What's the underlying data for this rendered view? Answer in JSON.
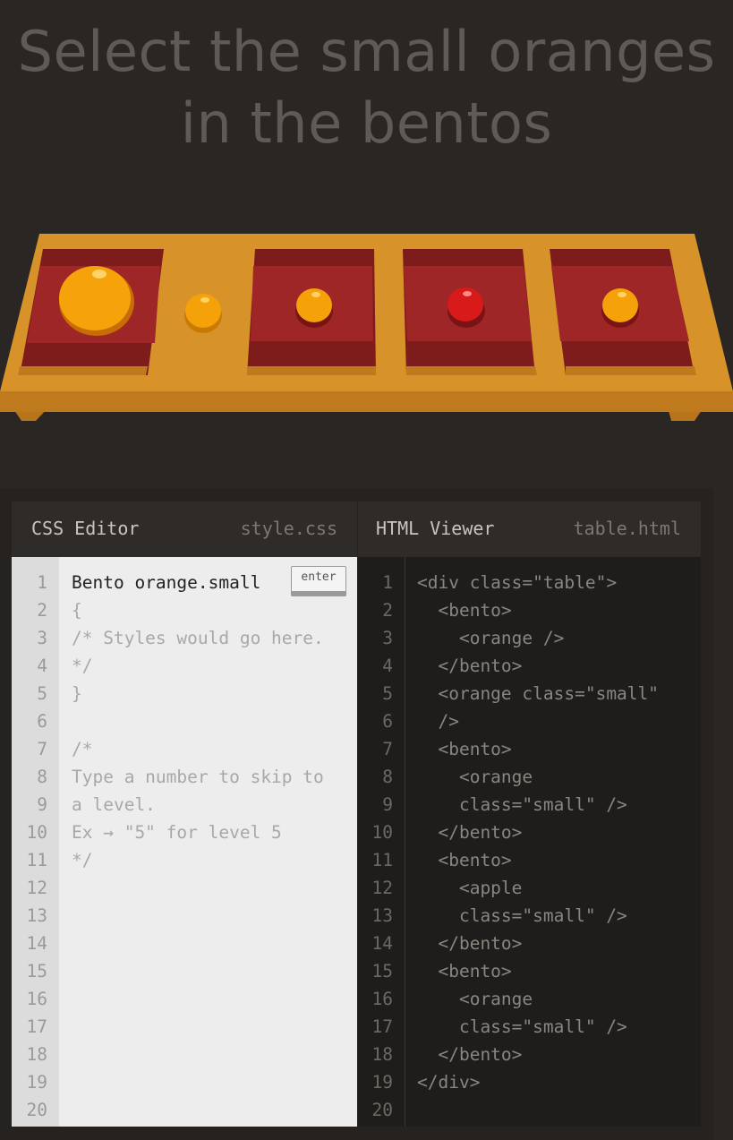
{
  "level": {
    "instruction_line1": "Select the small oranges",
    "instruction_line2": "in the bentos"
  },
  "table_items": [
    {
      "type": "bento",
      "contains": "orange"
    },
    {
      "type": "orange",
      "class": "small"
    },
    {
      "type": "bento",
      "contains": "orange small"
    },
    {
      "type": "bento",
      "contains": "apple small"
    },
    {
      "type": "bento",
      "contains": "orange small"
    }
  ],
  "colors": {
    "background": "#2a2623",
    "table": "#d8922a",
    "bento": "#8f1e1e",
    "orange": "#f29e0a",
    "apple": "#d91a1a"
  },
  "css_editor": {
    "title": "CSS Editor",
    "filename": "style.css",
    "enter_label": "enter",
    "input_value": "Bento orange.small",
    "line_numbers": [
      "1",
      "2",
      "3",
      "4",
      "5",
      "6",
      "7",
      "8",
      "9",
      "10",
      "11",
      "12",
      "13",
      "14",
      "15",
      "16",
      "17",
      "18",
      "19",
      "20"
    ],
    "lines": [
      "{",
      "/* Styles would go here.",
      "*/",
      "}",
      "",
      "/*",
      "Type a number to skip to",
      "a level.",
      "Ex → \"5\" for level 5",
      "*/"
    ]
  },
  "html_viewer": {
    "title": "HTML Viewer",
    "filename": "table.html",
    "line_numbers": [
      "1",
      "2",
      "3",
      "4",
      "5",
      "6",
      "7",
      "8",
      "9",
      "10",
      "11",
      "12",
      "13",
      "14",
      "15",
      "16",
      "17",
      "18",
      "19",
      "20"
    ],
    "lines": [
      "<div class=\"table\">",
      "  <bento>",
      "    <orange />",
      "  </bento>",
      "  <orange class=\"small\"",
      "  />",
      "  <bento>",
      "    <orange",
      "    class=\"small\" />",
      "  </bento>",
      "  <bento>",
      "    <apple",
      "    class=\"small\" />",
      "  </bento>",
      "  <bento>",
      "    <orange",
      "    class=\"small\" />",
      "  </bento>",
      "</div>",
      ""
    ]
  }
}
